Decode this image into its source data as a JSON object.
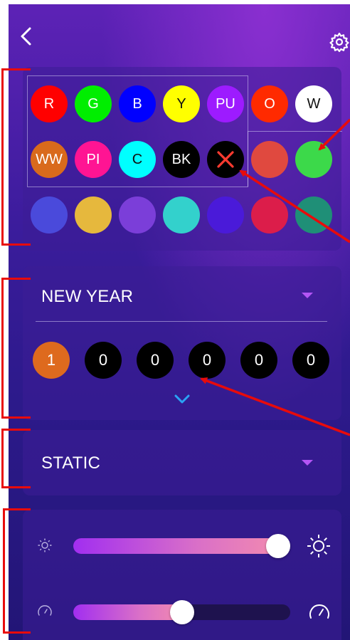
{
  "colors": {
    "accent": "#b455f5",
    "chevron": "#2aa3f5",
    "annotation": "#e80b0b"
  },
  "header": {
    "back_icon": "chevron-left-icon",
    "settings_icon": "gear-icon"
  },
  "palette": {
    "presets": [
      {
        "label": "R",
        "color": "#ff0000"
      },
      {
        "label": "G",
        "color": "#00ee00"
      },
      {
        "label": "B",
        "color": "#0000ff"
      },
      {
        "label": "Y",
        "color": "#ffff00",
        "text_color": "#111111"
      },
      {
        "label": "PU",
        "color": "#9d1bff"
      },
      {
        "label": "O",
        "color": "#ff2a00"
      },
      {
        "label": "W",
        "color": "#ffffff",
        "text_color": "#111111"
      },
      {
        "label": "WW",
        "color": "#d96a1c"
      },
      {
        "label": "PI",
        "color": "#ff1493"
      },
      {
        "label": "C",
        "color": "#00ffff",
        "text_color": "#111111"
      },
      {
        "label": "BK",
        "color": "#000000"
      }
    ],
    "clear_icon": "close-icon",
    "custom_row2": [
      "#e0493f",
      "#3cd94a"
    ],
    "custom_row3": [
      "#4a4adb",
      "#e6b83d",
      "#7b3ed9",
      "#33d1cc",
      "#4a1ad9",
      "#dc1d4a",
      "#1f8f77"
    ]
  },
  "mode": {
    "title": "NEW YEAR",
    "sequence": [
      "1",
      "0",
      "0",
      "0",
      "0",
      "0"
    ],
    "active_color": "#de6a1e",
    "expand_icon": "chevron-down-icon"
  },
  "effect": {
    "title": "STATIC"
  },
  "sliders": {
    "brightness": {
      "value": 1.0,
      "min_icon": "sun-small-icon",
      "max_icon": "sun-large-icon"
    },
    "speed": {
      "value": 0.5,
      "min_icon": "speedometer-small-icon",
      "max_icon": "speedometer-large-icon"
    }
  }
}
